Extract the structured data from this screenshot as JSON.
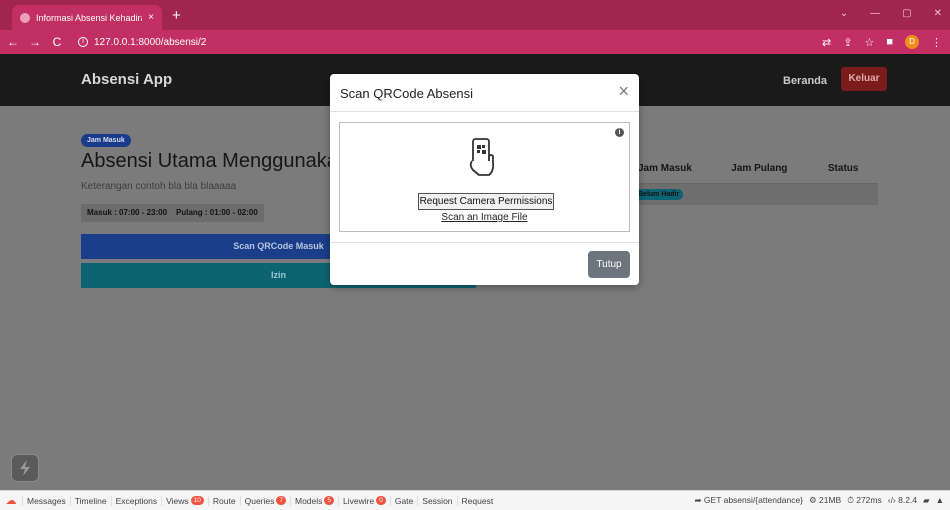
{
  "browser": {
    "tab_title": "Informasi Absensi Kehadiran | Al",
    "tab_close": "×",
    "new_tab": "+",
    "url": "127.0.0.1:8000/absensi/2",
    "back": "←",
    "forward": "→",
    "reload": "C",
    "win_min": "—",
    "win_max": "▢",
    "win_close": "✕",
    "win_chevron": "⌄",
    "profile_initial": "D"
  },
  "navbar": {
    "brand": "Absensi App",
    "home": "Beranda",
    "logout": "Keluar"
  },
  "main": {
    "badge": "Jam Masuk",
    "title": "Absensi Utama Menggunakan",
    "subtitle": "Keterangan contoh bla bla blaaaaa",
    "schedule_in": "Masuk : 07:00 - 23:00",
    "schedule_out": "Pulang : 01:00 - 02:00",
    "scan_button": "Scan QRCode Masuk",
    "izin_button": "Izin"
  },
  "table": {
    "headers": [
      "Jam Masuk",
      "Jam Pulang",
      "Status"
    ],
    "row": {
      "status_pill": "Belum Hadir"
    }
  },
  "modal": {
    "title": "Scan QRCode Absensi",
    "close": "×",
    "info": "i",
    "request_permission": "Request Camera Permissions",
    "scan_image": "Scan an Image File",
    "close_button": "Tutup"
  },
  "debugbar": {
    "tabs": [
      {
        "label": "Messages"
      },
      {
        "label": "Timeline"
      },
      {
        "label": "Exceptions"
      },
      {
        "label": "Views",
        "count": "10"
      },
      {
        "label": "Route"
      },
      {
        "label": "Queries",
        "count": "7"
      },
      {
        "label": "Models",
        "count": "5"
      },
      {
        "label": "Livewire",
        "count": "0"
      },
      {
        "label": "Gate"
      },
      {
        "label": "Session"
      },
      {
        "label": "Request"
      }
    ],
    "request": "GET absensi/{attendance}",
    "memory": "21MB",
    "time": "272ms",
    "php_version": "8.2.4"
  },
  "colors": {
    "browser_accent": "#c22f62",
    "primary": "#1a3e89",
    "info": "#0d6471",
    "danger": "#7c1b1b",
    "secondary_button": "#6c757d"
  }
}
